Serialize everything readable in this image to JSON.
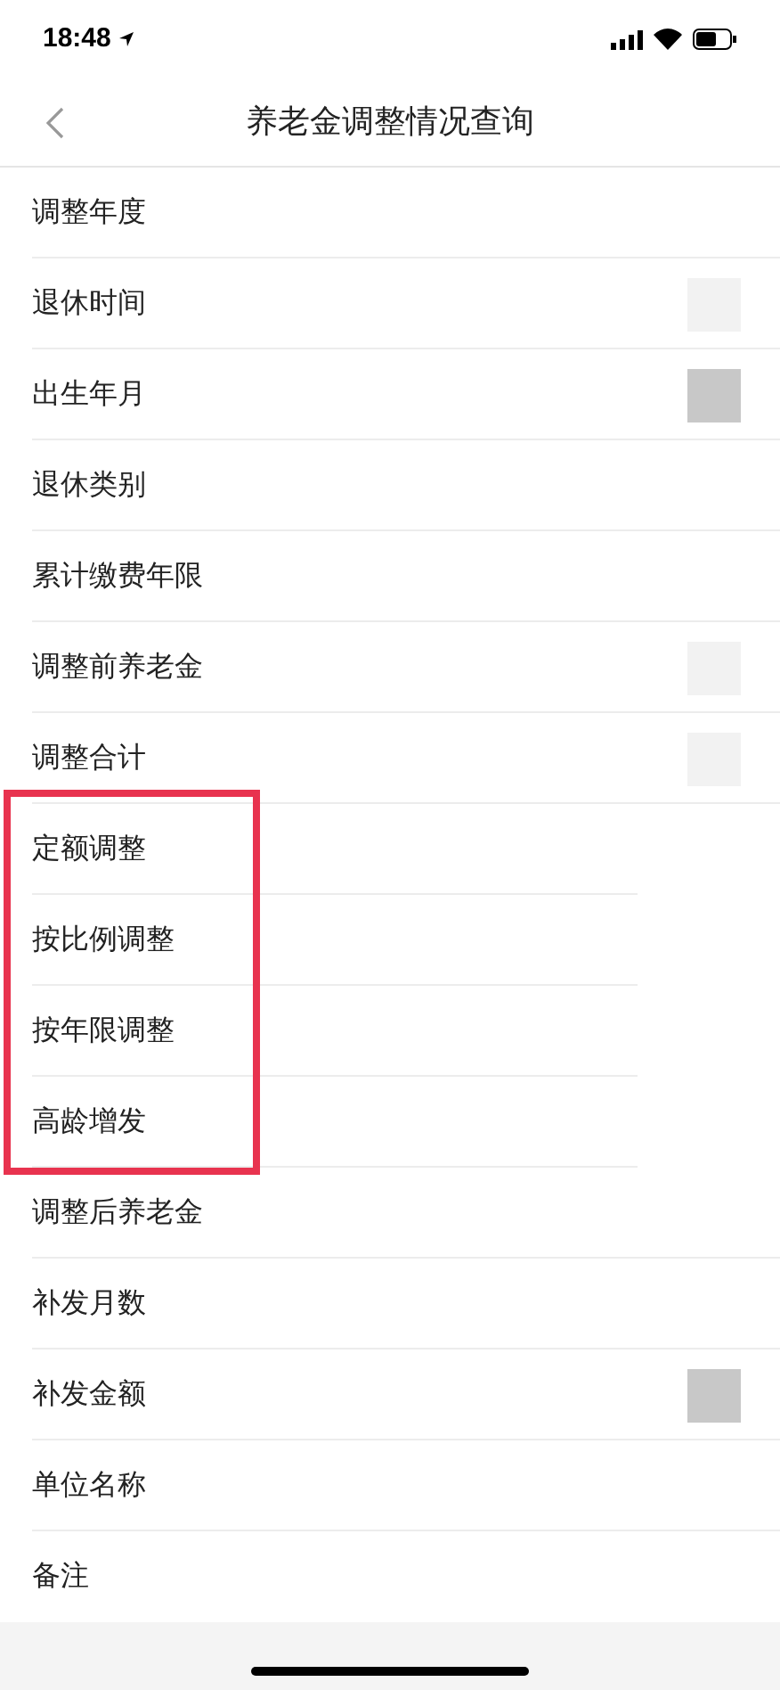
{
  "status_bar": {
    "time": "18:48"
  },
  "nav": {
    "title": "养老金调整情况查询"
  },
  "rows": [
    {
      "label": "调整年度",
      "highlighted": false
    },
    {
      "label": "退休时间",
      "highlighted": false,
      "color": "#f2f2f2"
    },
    {
      "label": "出生年月",
      "highlighted": false,
      "color": "#c8c8c8"
    },
    {
      "label": "退休类别",
      "highlighted": false
    },
    {
      "label": "累计缴费年限",
      "highlighted": false
    },
    {
      "label": "调整前养老金",
      "highlighted": false,
      "color": "#f2f2f2"
    },
    {
      "label": "调整合计",
      "highlighted": false,
      "color": "#f2f2f2"
    },
    {
      "label": "定额调整",
      "highlighted": true
    },
    {
      "label": "按比例调整",
      "highlighted": true
    },
    {
      "label": "按年限调整",
      "highlighted": true
    },
    {
      "label": "高龄增发",
      "highlighted": true
    },
    {
      "label": "调整后养老金",
      "highlighted": false
    },
    {
      "label": "补发月数",
      "highlighted": false
    },
    {
      "label": "补发金额",
      "highlighted": false,
      "color": "#c8c8c8"
    },
    {
      "label": "单位名称",
      "highlighted": false
    },
    {
      "label": "备注",
      "highlighted": false
    }
  ]
}
